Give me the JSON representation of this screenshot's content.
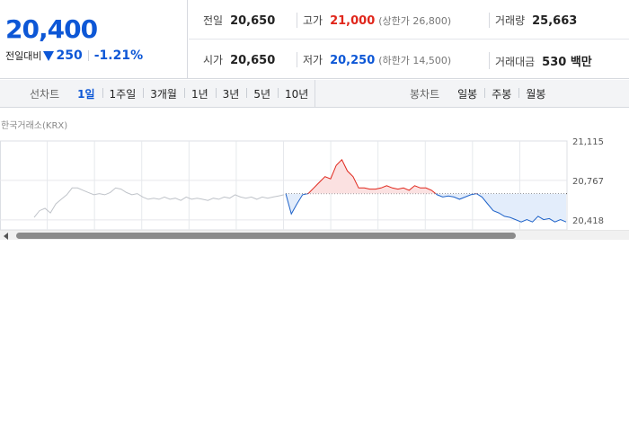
{
  "quote": {
    "price": "20,400",
    "change_label": "전일대비",
    "direction_icon": "down-triangle-icon",
    "change": "250",
    "change_rate": "-1.21%",
    "colors": {
      "down": "#0d57d6",
      "up": "#e0261b"
    },
    "stats": {
      "prev_close": {
        "label": "전일",
        "value": "20,650"
      },
      "high": {
        "label": "고가",
        "value": "21,000",
        "limit_text": "(상한가 26,800)"
      },
      "volume": {
        "label": "거래량",
        "value": "25,663"
      },
      "open": {
        "label": "시가",
        "value": "20,650"
      },
      "low": {
        "label": "저가",
        "value": "20,250",
        "limit_text": "(하한가 14,500)"
      },
      "trade_value": {
        "label": "거래대금",
        "value": "530 백만"
      }
    }
  },
  "period_tabs": {
    "line_label": "선차트",
    "line_tabs": [
      "1일",
      "1주일",
      "3개월",
      "1년",
      "3년",
      "5년",
      "10년"
    ],
    "line_active": "1일",
    "candle_label": "봉차트",
    "candle_tabs": [
      "일봉",
      "주봉",
      "월봉"
    ]
  },
  "chart": {
    "source_label": "한국거래소(KRX)",
    "y_ticks": [
      "21,115",
      "20,767",
      "20,418"
    ],
    "reference_price": 20650
  },
  "chart_data": {
    "type": "line",
    "title": "",
    "xlabel": "",
    "ylabel": "",
    "ylim": [
      20330,
      21115
    ],
    "baseline": 20650,
    "grid": true,
    "series": [
      {
        "segment": "previous-day",
        "values": [
          20440,
          20500,
          20520,
          20480,
          20560,
          20600,
          20640,
          20700,
          20700,
          20680,
          20660,
          20640,
          20650,
          20640,
          20660,
          20700,
          20690,
          20660,
          20640,
          20650,
          20620,
          20600,
          20610,
          20600,
          20620,
          20600,
          20610,
          20590,
          20620,
          20600,
          20610,
          20600,
          20590,
          20610,
          20600,
          20620,
          20610,
          20640,
          20620,
          20610,
          20620,
          20600,
          20620,
          20610,
          20620,
          20630,
          20640
        ]
      },
      {
        "segment": "today",
        "values": [
          20650,
          20470,
          20560,
          20640,
          20650,
          20700,
          20750,
          20800,
          20780,
          20900,
          20950,
          20850,
          20800,
          20700,
          20700,
          20690,
          20690,
          20700,
          20720,
          20700,
          20690,
          20700,
          20680,
          20720,
          20700,
          20700,
          20680,
          20640,
          20620,
          20630,
          20620,
          20600,
          20620,
          20640,
          20650,
          20620,
          20560,
          20500,
          20480,
          20450,
          20440,
          20420,
          20400,
          20420,
          20400,
          20450,
          20420,
          20430,
          20400,
          20420,
          20400
        ]
      }
    ]
  }
}
